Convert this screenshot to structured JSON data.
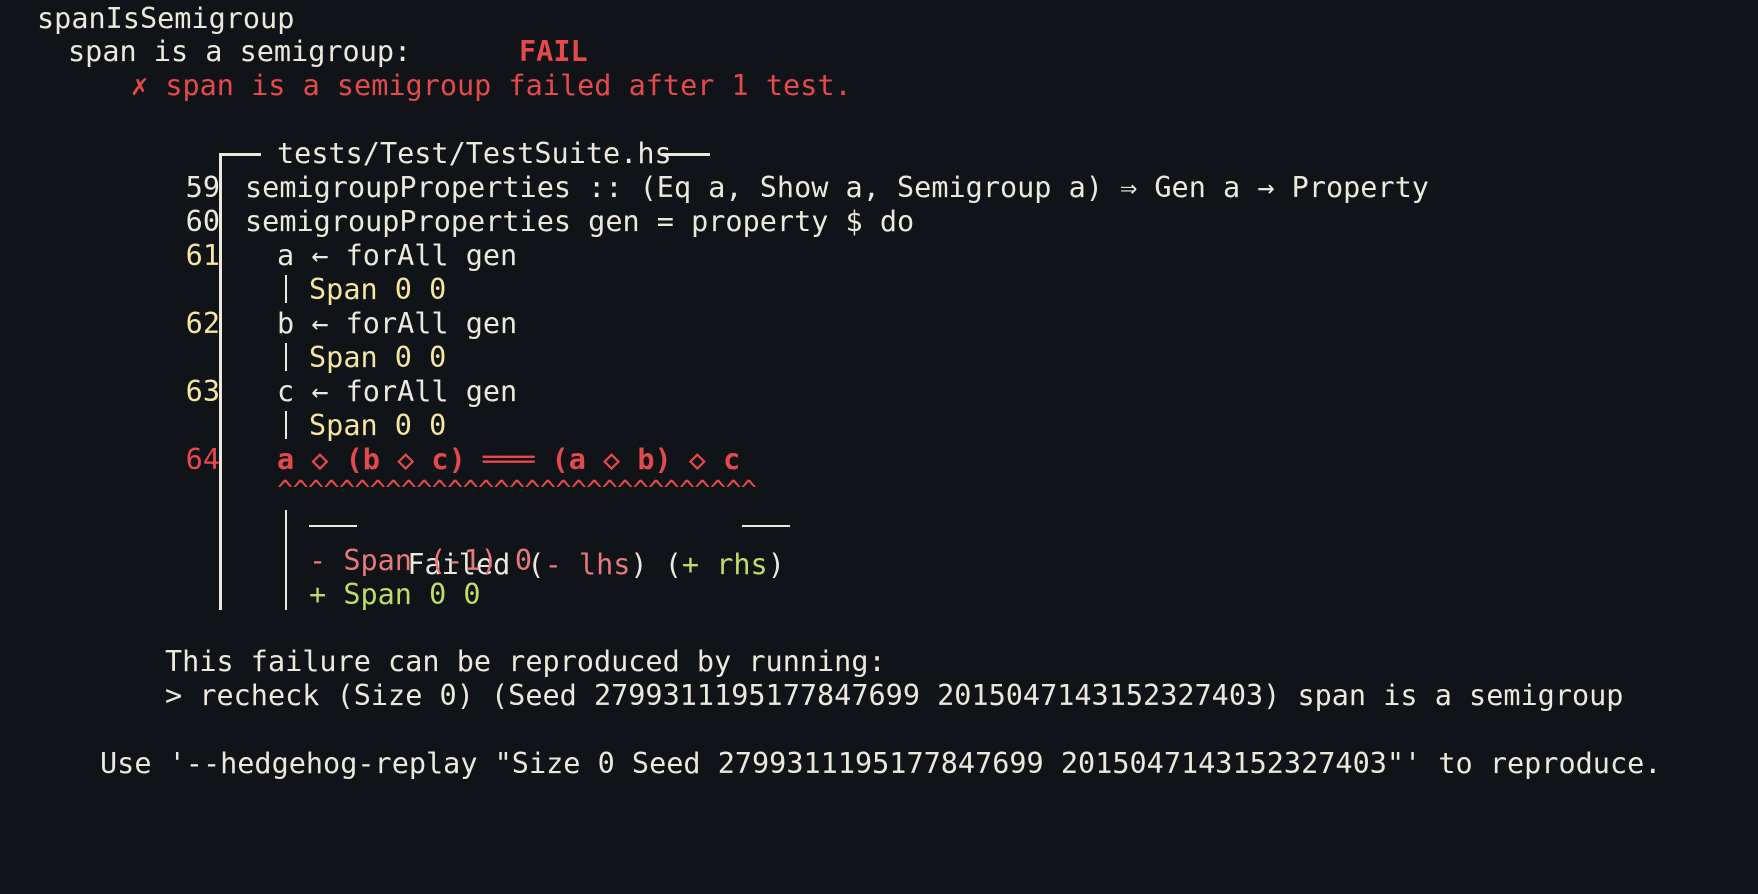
{
  "group_name": "spanIsSemigroup",
  "property": {
    "name": "span is a semigroup:",
    "status": "FAIL",
    "failure_message": "✗ span is a semigroup failed after 1 test."
  },
  "source": {
    "file_header": "tests/Test/TestSuite.hs",
    "lines": [
      {
        "number": "59",
        "code": "semigroupProperties :: (Eq a, Show a, Semigroup a) ⇒ Gen a → Property"
      },
      {
        "number": "60",
        "code": "semigroupProperties gen = property $ do"
      },
      {
        "number": "61",
        "code": "a ← forAll gen",
        "value": "Span 0 0"
      },
      {
        "number": "62",
        "code": "b ← forAll gen",
        "value": "Span 0 0"
      },
      {
        "number": "63",
        "code": "c ← forAll gen",
        "value": "Span 0 0"
      },
      {
        "number": "64",
        "code": "a ◇ (b ◇ c) ═══ (a ◇ b) ◇ c"
      }
    ],
    "carets": "^^^^^^^^^^^^^^^^^^^^^^^^^^^^^^^"
  },
  "diff": {
    "title_prefix": "Failed (",
    "lhs_label": "- lhs",
    "mid": ") (",
    "rhs_label": "+ rhs",
    "title_suffix": ")",
    "minus_line": "- Span (-1) 0",
    "plus_line": "+ Span 0 0"
  },
  "reproduce": {
    "intro": "This failure can be reproduced by running:",
    "command": "> recheck (Size 0) (Seed 2799311195177847699 2015047143152327403) span is a semigroup"
  },
  "replay_hint": "Use '--hedgehog-replay \"Size 0 Seed 2799311195177847699 2015047143152327403\"' to reproduce.",
  "colors": {
    "background": "#101419",
    "foreground": "#ece9dc",
    "error": "#e6494b",
    "diff_minus": "#e8787a",
    "diff_plus": "#bfdc66",
    "highlight": "#f5e6a0"
  }
}
